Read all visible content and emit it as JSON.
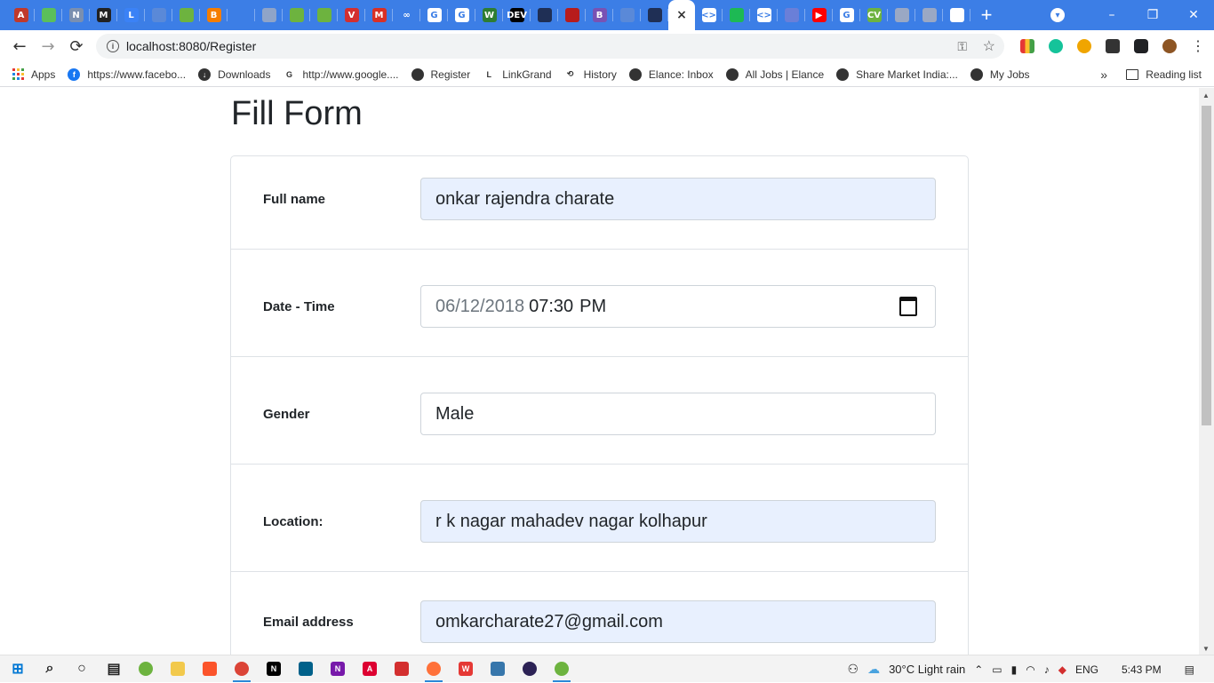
{
  "browser": {
    "tabs": [
      {
        "icon": "a-letter-icon",
        "glyph": "A",
        "color": "#c0392b"
      },
      {
        "icon": "leaf-icon",
        "glyph": "",
        "color": "#5bbf5b"
      },
      {
        "icon": "n-letter-icon",
        "glyph": "N",
        "color": "#7a8fb0"
      },
      {
        "icon": "medium-icon",
        "glyph": "M",
        "color": "#222222"
      },
      {
        "icon": "l-letter-icon",
        "glyph": "L",
        "color": "#3b82f6"
      },
      {
        "icon": "page-icon",
        "glyph": "",
        "color": "#5a89d8"
      },
      {
        "icon": "leaf-icon",
        "glyph": "",
        "color": "#6db33f"
      },
      {
        "icon": "blogger-icon",
        "glyph": "B",
        "color": "#f57d00"
      },
      {
        "icon": "blank-icon",
        "glyph": "",
        "color": "#3c7ee6"
      },
      {
        "icon": "shield-icon",
        "glyph": "",
        "color": "#8fa4c8"
      },
      {
        "icon": "leaf-icon",
        "glyph": "",
        "color": "#6db33f"
      },
      {
        "icon": "leaf-icon",
        "glyph": "",
        "color": "#6db33f"
      },
      {
        "icon": "vue-icon",
        "glyph": "V",
        "color": "#d32f2f"
      },
      {
        "icon": "gmail-icon",
        "glyph": "M",
        "color": "#d93025"
      },
      {
        "icon": "infinity-icon",
        "glyph": "∞",
        "color": "#3c7ee6"
      },
      {
        "icon": "google-icon",
        "glyph": "G",
        "color": "#ffffff"
      },
      {
        "icon": "google-icon",
        "glyph": "G",
        "color": "#ffffff"
      },
      {
        "icon": "w-letter-icon",
        "glyph": "W",
        "color": "#2e7d32"
      },
      {
        "icon": "dev-icon",
        "glyph": "DEV",
        "color": "#000000"
      },
      {
        "icon": "globe-icon",
        "glyph": "",
        "color": "#1f2f55"
      },
      {
        "icon": "record-icon",
        "glyph": "",
        "color": "#b71c1c"
      },
      {
        "icon": "bootstrap-icon",
        "glyph": "B",
        "color": "#7952b3"
      },
      {
        "icon": "page-icon",
        "glyph": "",
        "color": "#5a89d8"
      },
      {
        "icon": "globe-icon",
        "glyph": "",
        "color": "#1f2f55"
      },
      {
        "icon": "close-icon",
        "glyph": "×",
        "color": "#ffffff"
      },
      {
        "icon": "code-icon",
        "glyph": "<>",
        "color": "#ffffff"
      },
      {
        "icon": "diamond-icon",
        "glyph": "",
        "color": "#1db954"
      },
      {
        "icon": "code-icon",
        "glyph": "<>",
        "color": "#ffffff"
      },
      {
        "icon": "page-icon",
        "glyph": "",
        "color": "#6a7fd8"
      },
      {
        "icon": "youtube-icon",
        "glyph": "▶",
        "color": "#ff0000"
      },
      {
        "icon": "google-icon",
        "glyph": "G",
        "color": "#ffffff"
      },
      {
        "icon": "cv-icon",
        "glyph": "CV",
        "color": "#6db33f"
      },
      {
        "icon": "page-icon",
        "glyph": "",
        "color": "#9aa8c4"
      },
      {
        "icon": "page-icon",
        "glyph": "",
        "color": "#9aa8c4"
      },
      {
        "icon": "github-icon",
        "glyph": "",
        "color": "#ffffff"
      }
    ],
    "new_tab": "+",
    "window_buttons": {
      "minimize": "–",
      "restore": "❐",
      "close": "✕"
    },
    "url": "localhost:8080/Register",
    "bookmarks": [
      {
        "label": "https://www.facebo...",
        "icon": "facebook-icon",
        "color": "#1877f2",
        "glyph": "f"
      },
      {
        "label": "Downloads",
        "icon": "download-icon",
        "color": "#333333",
        "glyph": "↓"
      },
      {
        "label": "http://www.google....",
        "icon": "google-icon",
        "color": "#ffffff",
        "glyph": "G"
      },
      {
        "label": "Register",
        "icon": "globe-icon",
        "color": "#333333",
        "glyph": ""
      },
      {
        "label": "LinkGrand",
        "icon": "l-letter-icon",
        "color": "#ffffff",
        "glyph": "L"
      },
      {
        "label": "History",
        "icon": "history-icon",
        "color": "#ffffff",
        "glyph": "⟲"
      },
      {
        "label": "Elance: Inbox",
        "icon": "globe-icon",
        "color": "#333333",
        "glyph": ""
      },
      {
        "label": "All Jobs | Elance",
        "icon": "globe-icon",
        "color": "#333333",
        "glyph": ""
      },
      {
        "label": "Share Market India:...",
        "icon": "globe-icon",
        "color": "#333333",
        "glyph": ""
      },
      {
        "label": "My Jobs",
        "icon": "globe-icon",
        "color": "#333333",
        "glyph": ""
      }
    ],
    "apps_label": "Apps",
    "more_bookmarks": "»",
    "reading_list": "Reading list"
  },
  "page": {
    "title": "Fill Form",
    "fields": {
      "full_name": {
        "label": "Full name",
        "value": "onkar  rajendra charate"
      },
      "datetime": {
        "label": "Date - Time",
        "date": "06/12/2018",
        "time": "07:30",
        "ampm": "PM"
      },
      "gender": {
        "label": "Gender",
        "value": "Male"
      },
      "location": {
        "label": "Location:",
        "value": "r k nagar mahadev nagar kolhapur"
      },
      "email": {
        "label": "Email address",
        "value": "omkarcharate27@gmail.com"
      }
    }
  },
  "taskbar": {
    "apps": [
      {
        "icon": "windows-start-icon",
        "color": "#0078d4",
        "glyph": "⊞"
      },
      {
        "icon": "search-icon",
        "color": "#222222",
        "glyph": "⌕"
      },
      {
        "icon": "cortana-icon",
        "color": "#222222",
        "glyph": "○"
      },
      {
        "icon": "task-view-icon",
        "color": "#222222",
        "glyph": "▤"
      },
      {
        "icon": "spring-icon",
        "color": "#6db33f",
        "glyph": ""
      },
      {
        "icon": "file-explorer-icon",
        "color": "#f2c94c",
        "glyph": ""
      },
      {
        "icon": "brave-icon",
        "color": "#fb542b",
        "glyph": ""
      },
      {
        "icon": "chrome-icon",
        "color": "#db4437",
        "glyph": ""
      },
      {
        "icon": "notion-icon",
        "color": "#000000",
        "glyph": "N"
      },
      {
        "icon": "mysql-icon",
        "color": "#00618a",
        "glyph": ""
      },
      {
        "icon": "onenote-icon",
        "color": "#7719aa",
        "glyph": "N"
      },
      {
        "icon": "angular-icon",
        "color": "#dd0031",
        "glyph": "A"
      },
      {
        "icon": "camera-icon",
        "color": "#d32f2f",
        "glyph": ""
      },
      {
        "icon": "firefox-icon",
        "color": "#ff7139",
        "glyph": ""
      },
      {
        "icon": "wps-icon",
        "color": "#e53935",
        "glyph": "W"
      },
      {
        "icon": "python-icon",
        "color": "#3776ab",
        "glyph": ""
      },
      {
        "icon": "eclipse-icon",
        "color": "#2c2255",
        "glyph": ""
      },
      {
        "icon": "spring-icon",
        "color": "#6db33f",
        "glyph": ""
      }
    ],
    "weather": "30°C  Light rain",
    "language": "ENG",
    "time": "5:43 PM"
  }
}
